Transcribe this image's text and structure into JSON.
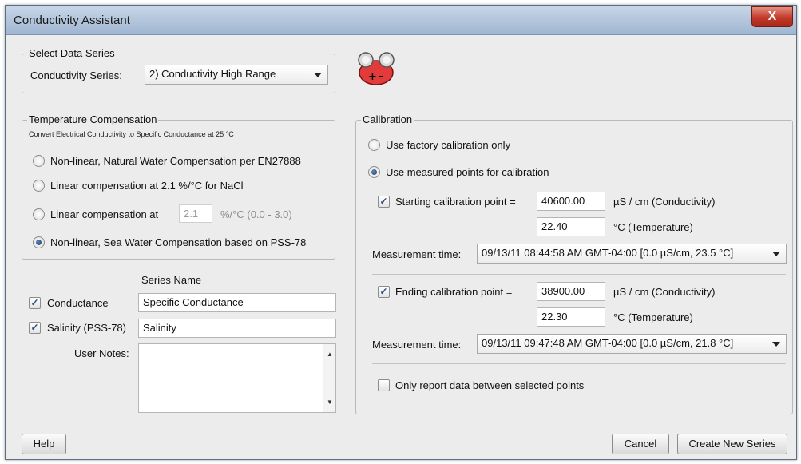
{
  "window": {
    "title": "Conductivity Assistant",
    "close_label": "X"
  },
  "select_series": {
    "group_title": "Select Data Series",
    "label": "Conductivity Series:",
    "value": "2) Conductivity High Range"
  },
  "temp_comp": {
    "group_title": "Temperature Compensation",
    "description": "Convert Electrical Conductivity to Specific Conductance at 25 °C",
    "options": [
      {
        "label": "Non-linear, Natural Water Compensation per EN27888",
        "selected": false
      },
      {
        "label": "Linear compensation at 2.1 %/°C for NaCl",
        "selected": false
      },
      {
        "label": "Linear compensation at",
        "selected": false
      },
      {
        "label": "Non-linear, Sea Water Compensation based on PSS-78",
        "selected": true
      }
    ],
    "linear_value": "2.1",
    "linear_unit": "%/°C  (0.0 - 3.0)"
  },
  "series": {
    "header": "Series Name",
    "conductance": {
      "label": "Conductance",
      "checked": true,
      "name": "Specific Conductance"
    },
    "salinity": {
      "label": "Salinity (PSS-78)",
      "checked": true,
      "name": "Salinity"
    },
    "notes_label": "User Notes:",
    "notes_value": ""
  },
  "calibration": {
    "group_title": "Calibration",
    "factory_label": "Use factory calibration only",
    "measured_label": "Use measured points for calibration",
    "selected": "measured",
    "start": {
      "label": "Starting calibration point =",
      "checked": true,
      "conductivity": "40600.00",
      "conductivity_unit": "µS / cm (Conductivity)",
      "temperature": "22.40",
      "temperature_unit": "°C (Temperature)",
      "time_label": "Measurement time:",
      "time_value": "09/13/11 08:44:58 AM GMT-04:00 [0.0 µS/cm, 23.5 °C]"
    },
    "end": {
      "label": "Ending calibration point =",
      "checked": true,
      "conductivity": "38900.00",
      "conductivity_unit": "µS / cm (Conductivity)",
      "temperature": "22.30",
      "temperature_unit": "°C (Temperature)",
      "time_label": "Measurement time:",
      "time_value": "09/13/11 09:47:48 AM GMT-04:00 [0.0 µS/cm, 21.8 °C]"
    },
    "only_report_label": "Only report data between selected points",
    "only_report_checked": false
  },
  "buttons": {
    "help": "Help",
    "cancel": "Cancel",
    "create": "Create New Series"
  },
  "colors": {
    "sensor_icon": "#e23b3b",
    "title_bar": "#b7c8de"
  }
}
